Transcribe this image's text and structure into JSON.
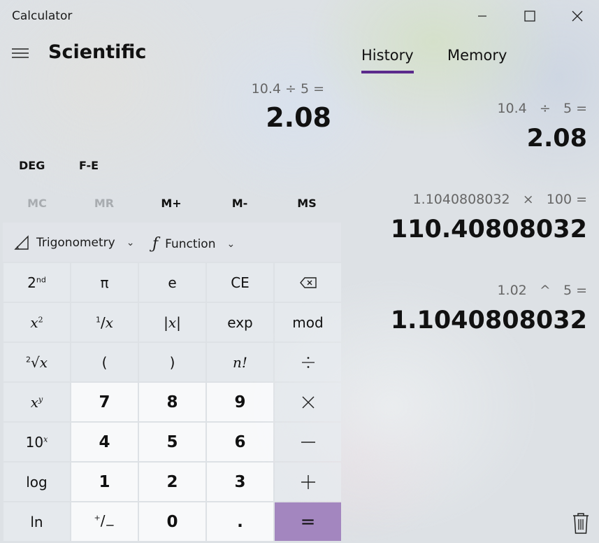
{
  "window": {
    "title": "Calculator",
    "minimize_icon": "minimize-icon",
    "maximize_icon": "maximize-icon",
    "close_icon": "close-icon"
  },
  "header": {
    "mode": "Scientific",
    "menu_icon": "hamburger-menu-icon"
  },
  "display": {
    "expression": "10.4 ÷ 5 =",
    "value": "2.08"
  },
  "modes": {
    "angle": "DEG",
    "notation": "F-E"
  },
  "memory_buttons": [
    {
      "label": "MC",
      "enabled": false
    },
    {
      "label": "MR",
      "enabled": false
    },
    {
      "label": "M+",
      "enabled": true
    },
    {
      "label": "M-",
      "enabled": true
    },
    {
      "label": "MS",
      "enabled": true
    }
  ],
  "dropdowns": {
    "trigonometry": "Trigonometry",
    "function": "Function"
  },
  "keys": {
    "second_sup": "nd",
    "pi": "π",
    "e": "e",
    "ce": "CE",
    "exp": "exp",
    "mod": "mod",
    "open_paren": "(",
    "close_paren": ")",
    "seven": "7",
    "eight": "8",
    "nine": "9",
    "four": "4",
    "five": "5",
    "six": "6",
    "one": "1",
    "two": "2",
    "three": "3",
    "log": "log",
    "ln": "ln",
    "zero": "0",
    "decimal": ".",
    "equals": "=",
    "backspace_icon": "backspace-icon"
  },
  "side_tabs": [
    {
      "label": "History",
      "active": true
    },
    {
      "label": "Memory",
      "active": false
    }
  ],
  "history": [
    {
      "a": "10.4",
      "op": "÷",
      "b": "5",
      "eq": "=",
      "result": "2.08"
    },
    {
      "a": "1.1040808032",
      "op": "×",
      "b": "100",
      "eq": "=",
      "result": "110.40808032"
    },
    {
      "a": "1.02",
      "op": "^",
      "b": "5",
      "eq": "=",
      "result": "1.1040808032"
    }
  ],
  "accent_color": "#a386bf",
  "tab_underline_color": "#5b2a8c",
  "trash_icon": "trash-icon"
}
